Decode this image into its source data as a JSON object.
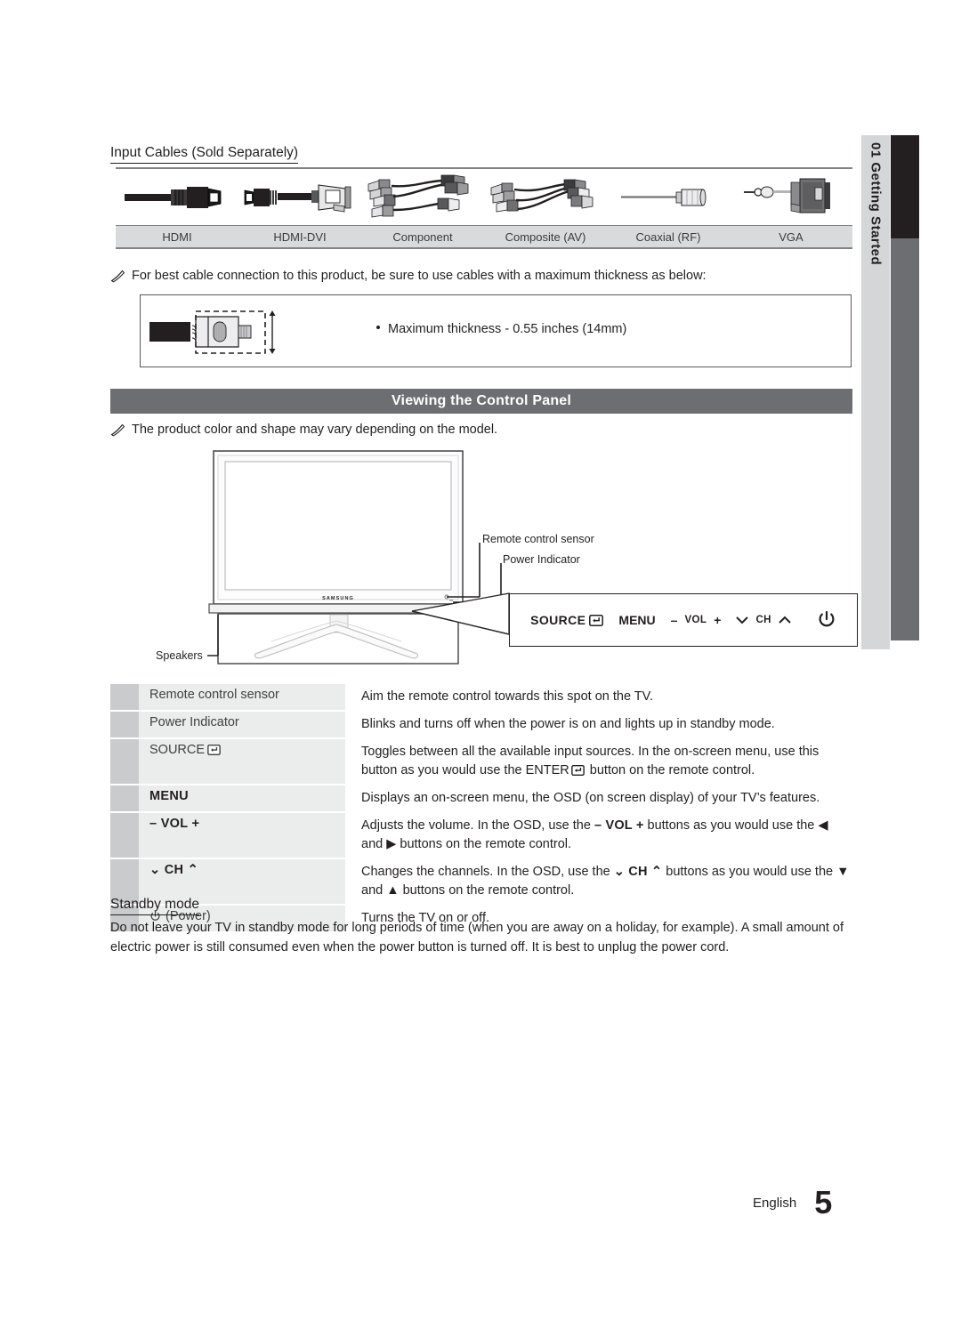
{
  "side_tab": {
    "chapter_number": "01",
    "chapter_title": "Getting Started",
    "label": "01  Getting Started"
  },
  "input_cables": {
    "heading": "Input Cables (Sold Separately)",
    "columns": [
      {
        "label": "HDMI",
        "icon": "hdmi-cable-icon"
      },
      {
        "label": "HDMI-DVI",
        "icon": "hdmi-dvi-cable-icon"
      },
      {
        "label": "Component",
        "icon": "component-cable-icon"
      },
      {
        "label": "Composite (AV)",
        "icon": "composite-cable-icon"
      },
      {
        "label": "Coaxial (RF)",
        "icon": "coaxial-cable-icon"
      },
      {
        "label": "VGA",
        "icon": "vga-cable-icon"
      }
    ]
  },
  "thickness_note": {
    "note": "For best cable connection to this product, be sure to use cables with a maximum thickness as below:",
    "bullet": "Maximum thickness - 0.55 inches (14mm)"
  },
  "control_panel": {
    "title": "Viewing the Control Panel",
    "note": "The product color and shape may vary depending on the model.",
    "callouts": {
      "remote_sensor": "Remote control sensor",
      "power_indicator": "Power Indicator",
      "speakers": "Speakers",
      "tv_brand": "SAMSUNG"
    },
    "panel_buttons": {
      "source": "SOURCE",
      "menu": "MENU",
      "vol_minus": "–",
      "vol": "VOL",
      "vol_plus": "+",
      "ch": "CH"
    }
  },
  "description_table": {
    "rows": [
      {
        "key": "Remote control sensor",
        "key_style": "plain",
        "value": "Aim the remote control towards this spot on the TV.",
        "height": "short"
      },
      {
        "key": "Power Indicator",
        "key_style": "plain",
        "value": "Blinks and turns off when the power is on and lights up in standby mode.",
        "height": "short"
      },
      {
        "key": "SOURCE",
        "key_style": "source",
        "value_part1": "Toggles between all the available input sources. In the on-screen menu, use this button as you would use the ",
        "value_kbd": "ENTER",
        "value_part2": " button on the remote control.",
        "height": "tall"
      },
      {
        "key": "MENU",
        "key_style": "bold",
        "value": "Displays an on-screen menu, the OSD (on screen display) of your TV’s features.",
        "height": "short"
      },
      {
        "key": "– VOL +",
        "key_style": "bold",
        "value_part1": "Adjusts the volume. In the OSD, use the ",
        "value_kbd": "– VOL +",
        "value_part2": " buttons as you would use the ◀ and ▶ buttons on the remote control.",
        "height": "tall"
      },
      {
        "key": "⌄ CH ⌃",
        "key_style": "ch",
        "value_part1": "Changes the channels. In the OSD, use the ",
        "value_kbd": "⌄ CH ⌃",
        "value_part2": " buttons as you would use the ▼ and ▲ buttons on the remote control.",
        "height": "tall"
      },
      {
        "key": "(Power)",
        "key_style": "power",
        "value": "Turns the TV on or off.",
        "height": "short"
      }
    ]
  },
  "standby": {
    "heading": "Standby mode",
    "body": "Do not leave your TV in standby mode for long periods of time (when you are away on a holiday, for example). A small amount of electric power is still consumed even when the power button is turned off. It is best to unplug the power cord."
  },
  "footer": {
    "language": "English",
    "page_number": "5"
  },
  "colors": {
    "tab_light": "#d4d6d8",
    "tab_black": "#231f20",
    "tab_gray": "#6d6e71",
    "title_bar": "#6d6e71",
    "cable_header": "#d9dadb",
    "desc_swatch": "#c9cbcd",
    "desc_key_bg": "#ebecec"
  }
}
